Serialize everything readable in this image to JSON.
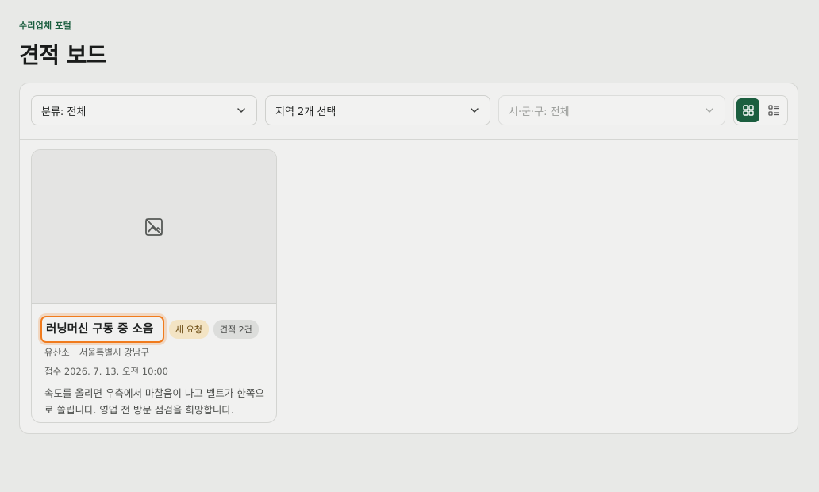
{
  "header": {
    "portal_label": "수리업체 포털",
    "title": "견적 보드"
  },
  "filters": {
    "category": "분류: 전체",
    "region": "지역 2개 선택",
    "district": "시·군·구: 전체"
  },
  "view_toggle": {
    "active": "grid"
  },
  "cards": [
    {
      "title": "러닝머신 구동 중 소음",
      "status_badge": "새 요청",
      "quote_badge": "견적 2건",
      "customer": "유산소",
      "location": "서울특별시 강남구",
      "received": "접수 2026. 7. 13. 오전 10:00",
      "description": "속도를 올리면 우측에서 마찰음이 나고 벨트가 한쪽으로 쏠립니다. 영업 전 방문 점검을 희망합니다."
    }
  ],
  "colors": {
    "accent": "#1b5e3f",
    "focus": "#f07b1d"
  }
}
